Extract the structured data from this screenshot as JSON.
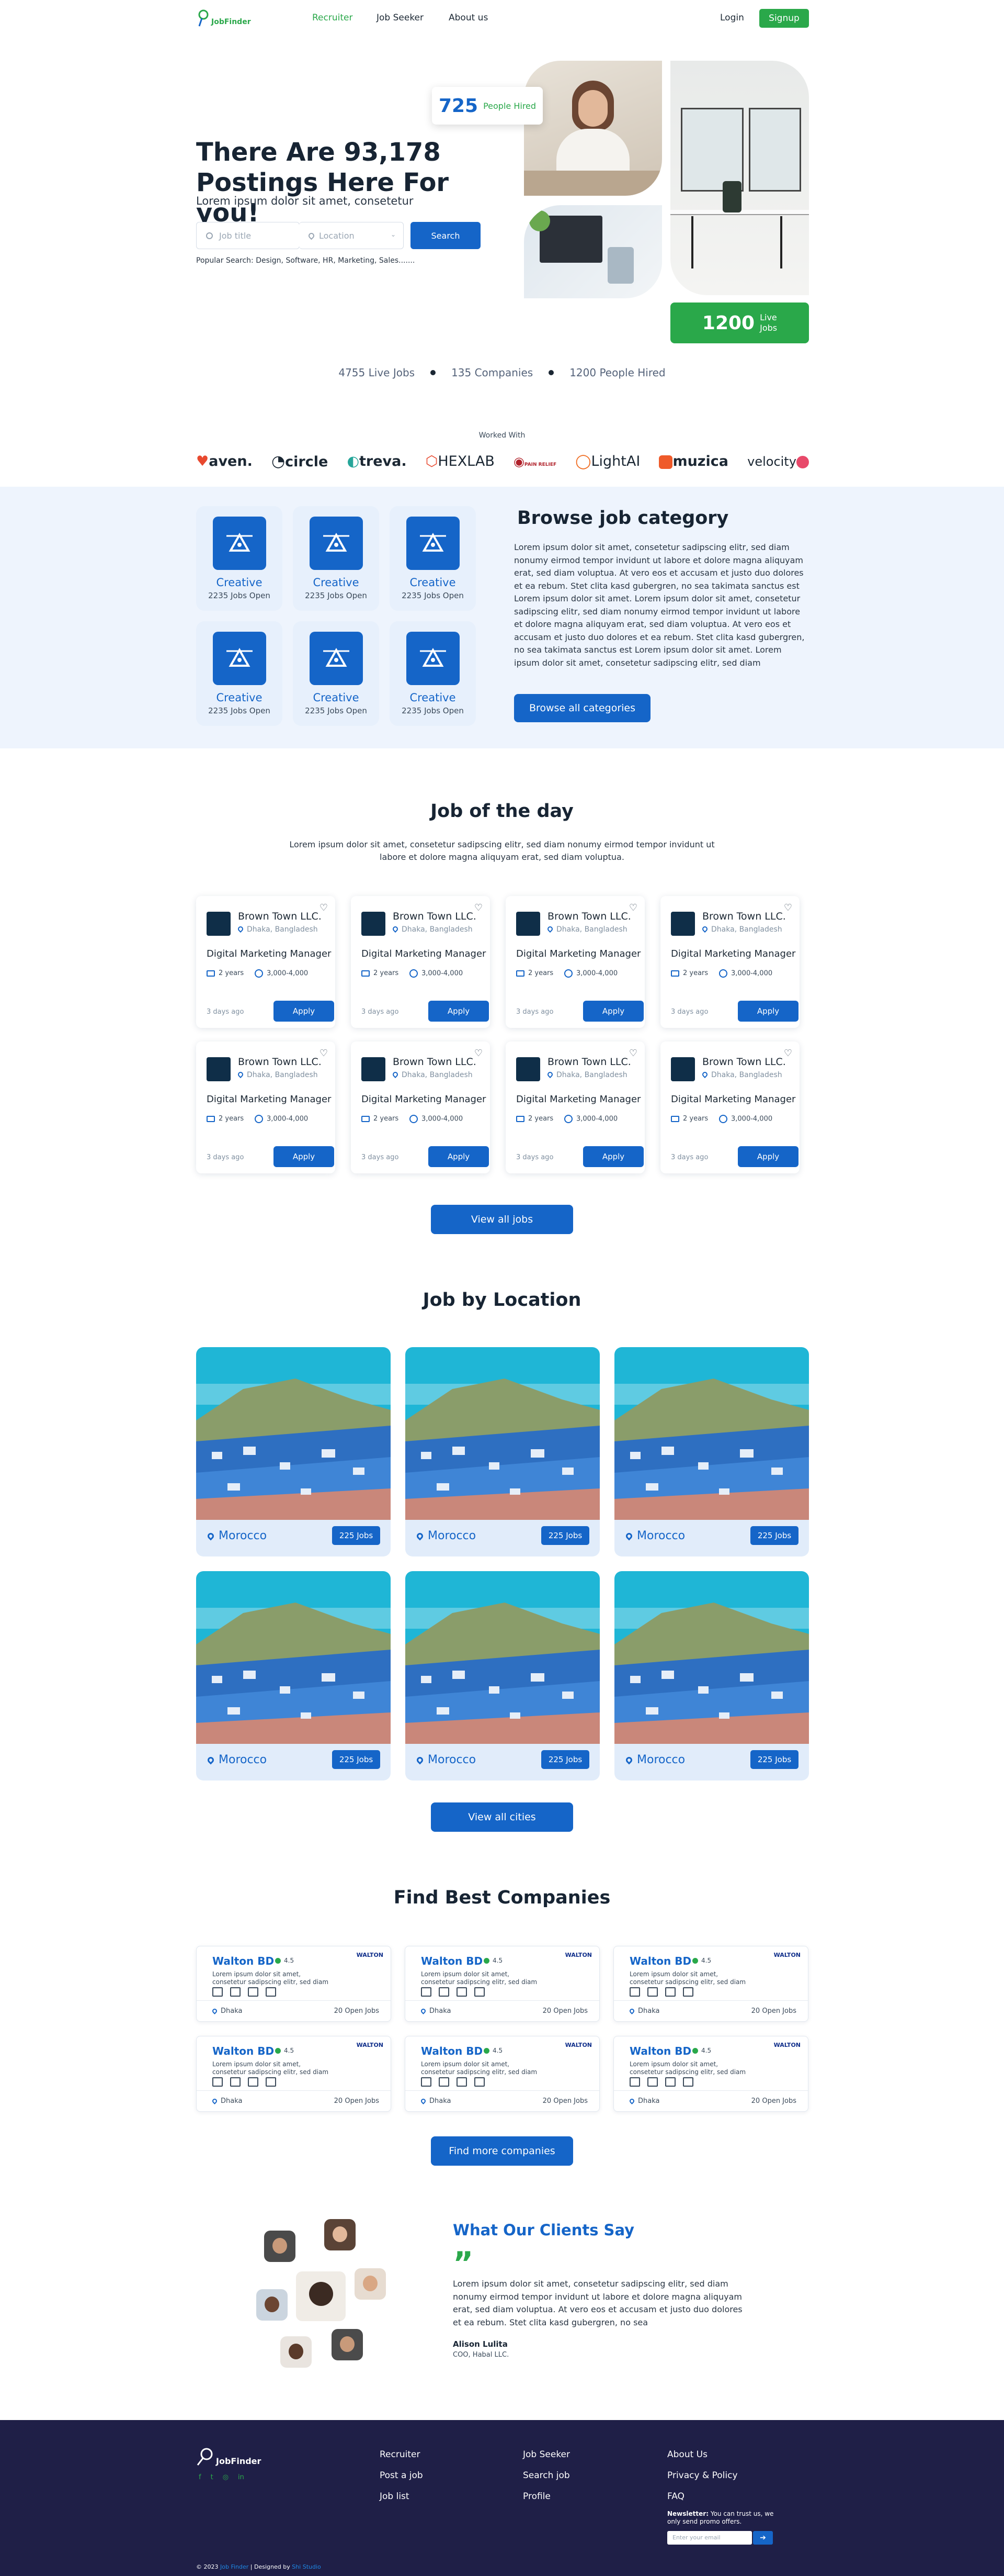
{
  "nav": {
    "brand": "JobFinder",
    "links": [
      "Recruiter",
      "Job Seeker",
      "About us"
    ],
    "login": "Login",
    "signup": "Signup"
  },
  "hero": {
    "title": "There Are 93,178 Postings Here For you!",
    "subtitle": "Lorem ipsum dolor sit amet, consetetur",
    "job_title_placeholder": "Job title",
    "location_placeholder": "Location",
    "search_button": "Search",
    "popular": "Popular Search: Design, Software, HR, Marketing, Sales.......",
    "hired_count": "725",
    "hired_label": "People Hired",
    "live_count": "1200",
    "live_label_1": "Live",
    "live_label_2": "Jobs"
  },
  "stats": [
    "4755 Live Jobs",
    "135 Companies",
    "1200 People Hired"
  ],
  "partners": {
    "title": "Worked With",
    "brands": [
      "aven.",
      "circle",
      "treva.",
      "HEXLAB",
      "PAIN RELIEF",
      "LightAI",
      "muzica",
      "velocity"
    ]
  },
  "categories": {
    "title": "Browse job category",
    "items": [
      {
        "name": "Creative",
        "jobs": "2235 Jobs Open"
      },
      {
        "name": "Creative",
        "jobs": "2235 Jobs Open"
      },
      {
        "name": "Creative",
        "jobs": "2235 Jobs Open"
      },
      {
        "name": "Creative",
        "jobs": "2235 Jobs Open"
      },
      {
        "name": "Creative",
        "jobs": "2235 Jobs Open"
      },
      {
        "name": "Creative",
        "jobs": "2235 Jobs Open"
      }
    ],
    "body": "Lorem ipsum dolor sit amet, consetetur sadipscing elitr, sed diam nonumy eirmod tempor invidunt ut labore et dolore magna aliquyam erat, sed diam voluptua. At vero eos et accusam et justo duo dolores et ea rebum. Stet clita kasd gubergren, no sea takimata sanctus est Lorem ipsum dolor sit amet. Lorem ipsum dolor sit amet, consetetur sadipscing elitr, sed diam nonumy eirmod tempor invidunt ut labore et dolore magna aliquyam erat, sed diam voluptua. At vero eos et accusam et justo duo dolores et ea rebum. Stet clita kasd gubergren, no sea takimata sanctus est Lorem ipsum dolor sit amet. Lorem ipsum dolor sit amet, consetetur sadipscing elitr, sed diam",
    "button": "Browse all categories"
  },
  "jobs": {
    "title": "Job of the day",
    "subtitle": "Lorem ipsum dolor sit amet, consetetur sadipscing elitr, sed diam nonumy eirmod tempor invidunt ut labore et dolore magna aliquyam erat, sed diam voluptua.",
    "items": [
      {
        "company": "Brown Town LLC.",
        "location": "Dhaka, Bangladesh",
        "title": "Digital Marketing Manager",
        "exp": "2 years",
        "salary": "3,000-4,000",
        "ago": "3 days ago",
        "apply": "Apply"
      },
      {
        "company": "Brown Town LLC.",
        "location": "Dhaka, Bangladesh",
        "title": "Digital Marketing Manager",
        "exp": "2 years",
        "salary": "3,000-4,000",
        "ago": "3 days ago",
        "apply": "Apply"
      },
      {
        "company": "Brown Town LLC.",
        "location": "Dhaka, Bangladesh",
        "title": "Digital Marketing Manager",
        "exp": "2 years",
        "salary": "3,000-4,000",
        "ago": "3 days ago",
        "apply": "Apply"
      },
      {
        "company": "Brown Town LLC.",
        "location": "Dhaka, Bangladesh",
        "title": "Digital Marketing Manager",
        "exp": "2 years",
        "salary": "3,000-4,000",
        "ago": "3 days ago",
        "apply": "Apply"
      },
      {
        "company": "Brown Town LLC.",
        "location": "Dhaka, Bangladesh",
        "title": "Digital Marketing Manager",
        "exp": "2 years",
        "salary": "3,000-4,000",
        "ago": "3 days ago",
        "apply": "Apply"
      },
      {
        "company": "Brown Town LLC.",
        "location": "Dhaka, Bangladesh",
        "title": "Digital Marketing Manager",
        "exp": "2 years",
        "salary": "3,000-4,000",
        "ago": "3 days ago",
        "apply": "Apply"
      },
      {
        "company": "Brown Town LLC.",
        "location": "Dhaka, Bangladesh",
        "title": "Digital Marketing Manager",
        "exp": "2 years",
        "salary": "3,000-4,000",
        "ago": "3 days ago",
        "apply": "Apply"
      },
      {
        "company": "Brown Town LLC.",
        "location": "Dhaka, Bangladesh",
        "title": "Digital Marketing Manager",
        "exp": "2 years",
        "salary": "3,000-4,000",
        "ago": "3 days ago",
        "apply": "Apply"
      }
    ],
    "button": "View all jobs"
  },
  "locations": {
    "title": "Job by Location",
    "items": [
      {
        "name": "Morocco",
        "jobs": "225 Jobs"
      },
      {
        "name": "Morocco",
        "jobs": "225 Jobs"
      },
      {
        "name": "Morocco",
        "jobs": "225 Jobs"
      },
      {
        "name": "Morocco",
        "jobs": "225 Jobs"
      },
      {
        "name": "Morocco",
        "jobs": "225 Jobs"
      },
      {
        "name": "Morocco",
        "jobs": "225 Jobs"
      }
    ],
    "button": "View all cities"
  },
  "companies": {
    "title": "Find Best Companies",
    "items": [
      {
        "name": "Walton BD",
        "rating": "4.5",
        "desc": "Lorem ipsum dolor sit amet, consetetur sadipscing elitr, sed diam",
        "brand": "WALTON",
        "location": "Dhaka",
        "open": "20 Open Jobs"
      },
      {
        "name": "Walton BD",
        "rating": "4.5",
        "desc": "Lorem ipsum dolor sit amet, consetetur sadipscing elitr, sed diam",
        "brand": "WALTON",
        "location": "Dhaka",
        "open": "20 Open Jobs"
      },
      {
        "name": "Walton BD",
        "rating": "4.5",
        "desc": "Lorem ipsum dolor sit amet, consetetur sadipscing elitr, sed diam",
        "brand": "WALTON",
        "location": "Dhaka",
        "open": "20 Open Jobs"
      },
      {
        "name": "Walton BD",
        "rating": "4.5",
        "desc": "Lorem ipsum dolor sit amet, consetetur sadipscing elitr, sed diam",
        "brand": "WALTON",
        "location": "Dhaka",
        "open": "20 Open Jobs"
      },
      {
        "name": "Walton BD",
        "rating": "4.5",
        "desc": "Lorem ipsum dolor sit amet, consetetur sadipscing elitr, sed diam",
        "brand": "WALTON",
        "location": "Dhaka",
        "open": "20 Open Jobs"
      },
      {
        "name": "Walton BD",
        "rating": "4.5",
        "desc": "Lorem ipsum dolor sit amet, consetetur sadipscing elitr, sed diam",
        "brand": "WALTON",
        "location": "Dhaka",
        "open": "20 Open Jobs"
      }
    ],
    "button": "Find more companies"
  },
  "testimonials": {
    "title": "What Our Clients Say",
    "quote": "Lorem ipsum dolor sit amet, consetetur sadipscing elitr, sed diam nonumy eirmod tempor invidunt ut labore et dolore magna aliquyam erat, sed diam voluptua. At vero eos et accusam et justo duo dolores et ea rebum. Stet clita kasd gubergren, no sea",
    "author": "Alison Lulita",
    "role": "COO, Habal LLC."
  },
  "footer": {
    "brand": "JobFinder",
    "col1": [
      "Recruiter",
      "Post a job",
      "Job list"
    ],
    "col2": [
      "Job Seeker",
      "Search job",
      "Profile"
    ],
    "col3": [
      "About Us",
      "Privacy & Policy",
      "FAQ"
    ],
    "newsletter_label": "Newsletter:",
    "newsletter_text": "You can trust us, we only send promo offers.",
    "email_placeholder": "Enter your email",
    "copyright": "© 2023",
    "copyright_brand": "Job Finder",
    "designed_by": "| Designed by",
    "designer": "Shi Studio"
  },
  "colors": {
    "primary": "#1565c8",
    "accent": "#2aa84a",
    "footer_bg": "#1f1f47",
    "soft_bg": "#eef4fd"
  }
}
